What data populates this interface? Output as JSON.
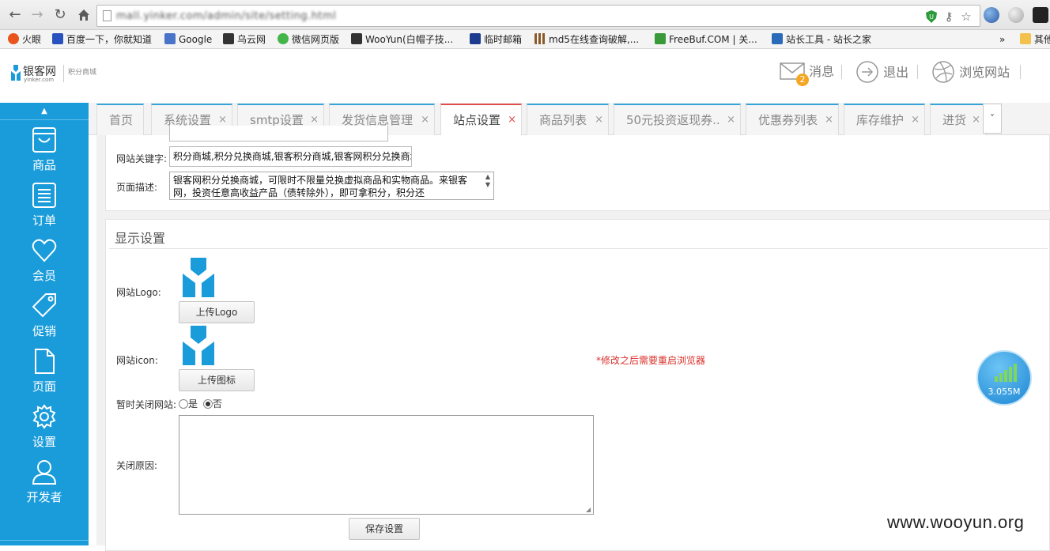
{
  "browser": {
    "url": "mall.yinker.com/admin/site/setting.html",
    "bookmarks": [
      {
        "label": "火眼",
        "color": "#e8541c"
      },
      {
        "label": "百度一下，你就知道",
        "color": "#2a52be"
      },
      {
        "label": "Google",
        "color": "#4a74c9"
      },
      {
        "label": "乌云网",
        "color": "#333333"
      },
      {
        "label": "微信网页版",
        "color": "#44b549"
      },
      {
        "label": "WooYun(白帽子技...",
        "color": "#333333"
      },
      {
        "label": "临时邮箱",
        "color": "#1d3c8f"
      },
      {
        "label": "md5在线查询破解,...",
        "color": "#8a5a2b"
      },
      {
        "label": "FreeBuf.COM | 关...",
        "color": "#3a9a3a"
      },
      {
        "label": "站长工具 - 站长之家",
        "color": "#2a6ab8"
      }
    ],
    "bookmarks_more": "»",
    "other_bookmarks": "其他"
  },
  "header": {
    "logo_text": "银客网",
    "logo_sub": "yinker.com",
    "logo2_text": "积分商城",
    "messages_label": "消息",
    "messages_count": "2",
    "logout_label": "退出",
    "browse_label": "浏览网站"
  },
  "sidebar": {
    "collapse_arrow": "▲",
    "items": [
      {
        "label": "商品",
        "icon": "cart-icon"
      },
      {
        "label": "订单",
        "icon": "list-icon"
      },
      {
        "label": "会员",
        "icon": "heart-icon"
      },
      {
        "label": "促销",
        "icon": "tag-icon"
      },
      {
        "label": "页面",
        "icon": "page-icon"
      },
      {
        "label": "设置",
        "icon": "gear-icon"
      },
      {
        "label": "开发者",
        "icon": "user-icon"
      }
    ]
  },
  "tabs": [
    {
      "label": "首页",
      "closable": false
    },
    {
      "label": "系统设置",
      "closable": true
    },
    {
      "label": "smtp设置",
      "closable": true
    },
    {
      "label": "发货信息管理",
      "closable": true
    },
    {
      "label": "站点设置",
      "closable": true,
      "active": true
    },
    {
      "label": "商品列表",
      "closable": true
    },
    {
      "label": "50元投资返现券..",
      "closable": true
    },
    {
      "label": "优惠券列表",
      "closable": true
    },
    {
      "label": "库存维护",
      "closable": true
    },
    {
      "label": "进货",
      "closable": true
    }
  ],
  "tab_close_glyph": "×",
  "tab_more_glyph": "˅",
  "form_top": {
    "keywords_label": "网站关键字:",
    "keywords_value": "积分商城,积分兑换商城,银客积分商城,银客网积分兑换商城",
    "description_label": "页面描述:",
    "description_value": "银客网积分兑换商城，可限时不限量兑换虚拟商品和实物商品。来银客网，投资任意高收益产品（债转除外），即可拿积分，积分还"
  },
  "display_settings": {
    "title": "显示设置",
    "logo_label": "网站Logo:",
    "upload_logo_button": "上传Logo",
    "icon_label": "网站icon:",
    "upload_icon_button": "上传图标",
    "restart_note": "*修改之后需要重启浏览器",
    "close_site_label": "暂时关闭网站:",
    "radio_yes": "是",
    "radio_no": "否",
    "radio_selected": "否",
    "close_reason_label": "关闭原因:",
    "close_reason_value": "",
    "save_button": "保存设置"
  },
  "net_widget": {
    "speed": "3.055M"
  },
  "watermark": "www.wooyun.org"
}
